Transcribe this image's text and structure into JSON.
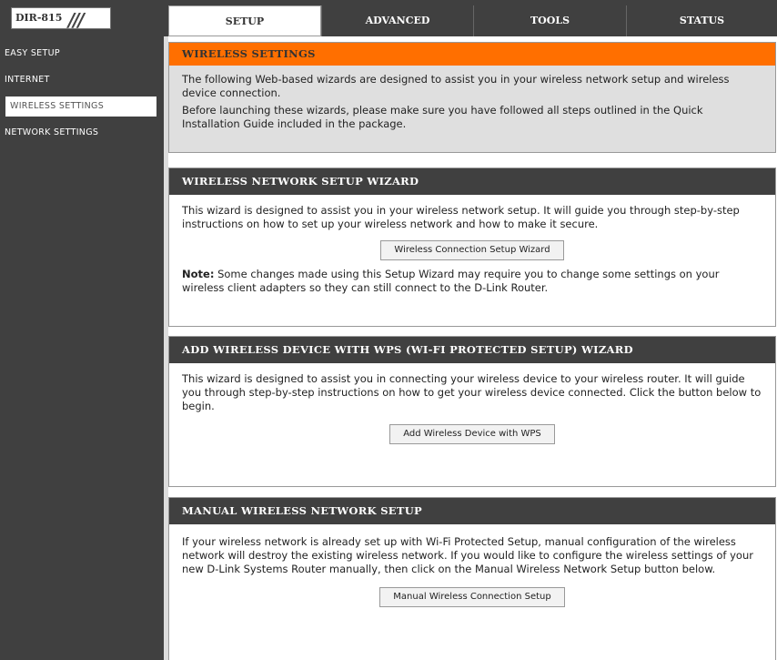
{
  "header": {
    "model": "DIR-815",
    "tabs": [
      {
        "label": "SETUP",
        "active": true
      },
      {
        "label": "ADVANCED"
      },
      {
        "label": "TOOLS"
      },
      {
        "label": "STATUS"
      }
    ]
  },
  "sidebar": {
    "items": [
      {
        "label": "EASY SETUP"
      },
      {
        "label": "INTERNET"
      },
      {
        "label": "WIRELESS SETTINGS",
        "active": true
      },
      {
        "label": "NETWORK SETTINGS"
      }
    ]
  },
  "intro": {
    "title": "WIRELESS SETTINGS",
    "p1": "The following Web-based wizards are designed to assist you in your wireless network setup and wireless device connection.",
    "p2": "Before launching these wizards, please make sure you have followed all steps outlined in the Quick Installation Guide included in the package."
  },
  "wizard": {
    "title": "WIRELESS NETWORK SETUP WIZARD",
    "text": "This wizard is designed to assist you in your wireless network setup. It will guide you through step-by-step instructions on how to set up your wireless network and how to make it secure.",
    "button": "Wireless Connection Setup Wizard",
    "note_label": "Note:",
    "note_text": " Some changes made using this Setup Wizard may require you to change some settings on your wireless client adapters so they can still connect to the D-Link Router."
  },
  "wps": {
    "title": "ADD WIRELESS DEVICE WITH WPS (WI-FI PROTECTED SETUP) WIZARD",
    "text": "This wizard is designed to assist you in connecting your wireless device to your wireless router. It will guide you through step-by-step instructions on how to get your wireless device connected. Click the button below to begin.",
    "button": "Add Wireless Device with WPS"
  },
  "manual": {
    "title": "MANUAL WIRELESS NETWORK SETUP",
    "text": "If your wireless network is already set up with Wi-Fi Protected Setup, manual configuration of the wireless network will destroy the existing wireless network. If you would like to configure the wireless settings of your new D-Link Systems Router manually, then click on the Manual Wireless Network Setup button below.",
    "button": "Manual Wireless Connection Setup"
  }
}
